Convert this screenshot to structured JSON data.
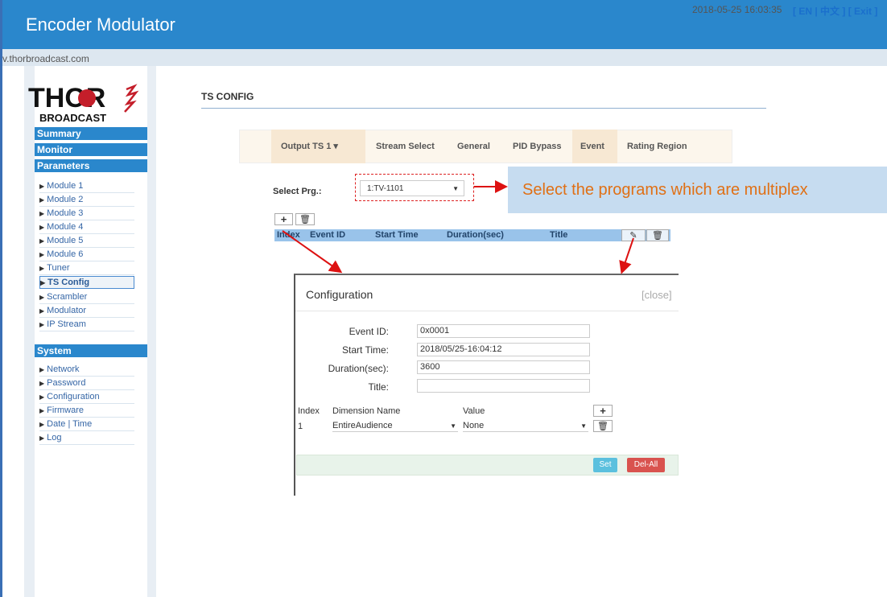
{
  "app": {
    "title": "Encoder Modulator",
    "url": "v.thorbroadcast.com",
    "datetime": "2018-05-25 16:03:35",
    "lang": "[ EN | 中文 ]  [ Exit ]"
  },
  "logo": {
    "brand": "THOR",
    "sub": "BROADCAST"
  },
  "sidebar": {
    "sections": [
      "Summary",
      "Monitor",
      "Parameters",
      "System"
    ],
    "parameters": [
      "Module 1",
      "Module 2",
      "Module 3",
      "Module 4",
      "Module 5",
      "Module 6",
      "Tuner",
      "TS Config",
      "Scrambler",
      "Modulator",
      "IP Stream"
    ],
    "system": [
      "Network",
      "Password",
      "Configuration",
      "Firmware",
      "Date | Time",
      "Log"
    ]
  },
  "page": {
    "title": "TS CONFIG"
  },
  "tabs": [
    "Output TS 1 ▾",
    "Stream Select",
    "General",
    "PID Bypass",
    "Event",
    "Rating Region"
  ],
  "select_prg": {
    "label": "Select Prg.:",
    "value": "1:TV-1101"
  },
  "callout": "Select the programs which are multiplex",
  "table": {
    "add": "+",
    "del": "🗑",
    "headers": [
      "Index",
      "Event ID",
      "Start Time",
      "Duration(sec)",
      "Title"
    ],
    "edit": "✎",
    "remove": "🗑"
  },
  "modal": {
    "title": "Configuration",
    "close": "[close]",
    "fields": [
      {
        "label": "Event ID:",
        "value": "0x0001"
      },
      {
        "label": "Start Time:",
        "value": "2018/05/25-16:04:12"
      },
      {
        "label": "Duration(sec):",
        "value": "3600"
      },
      {
        "label": "Title:",
        "value": ""
      }
    ],
    "dim_headers": [
      "Index",
      "Dimension Name",
      "Value"
    ],
    "dim_row": {
      "index": "1",
      "name": "EntireAudience",
      "value": "None"
    },
    "set": "Set",
    "delall": "Del-All"
  },
  "colors": {
    "header": "#2a87cc",
    "callout_text": "#e07015",
    "arrow": "#dd1111"
  }
}
